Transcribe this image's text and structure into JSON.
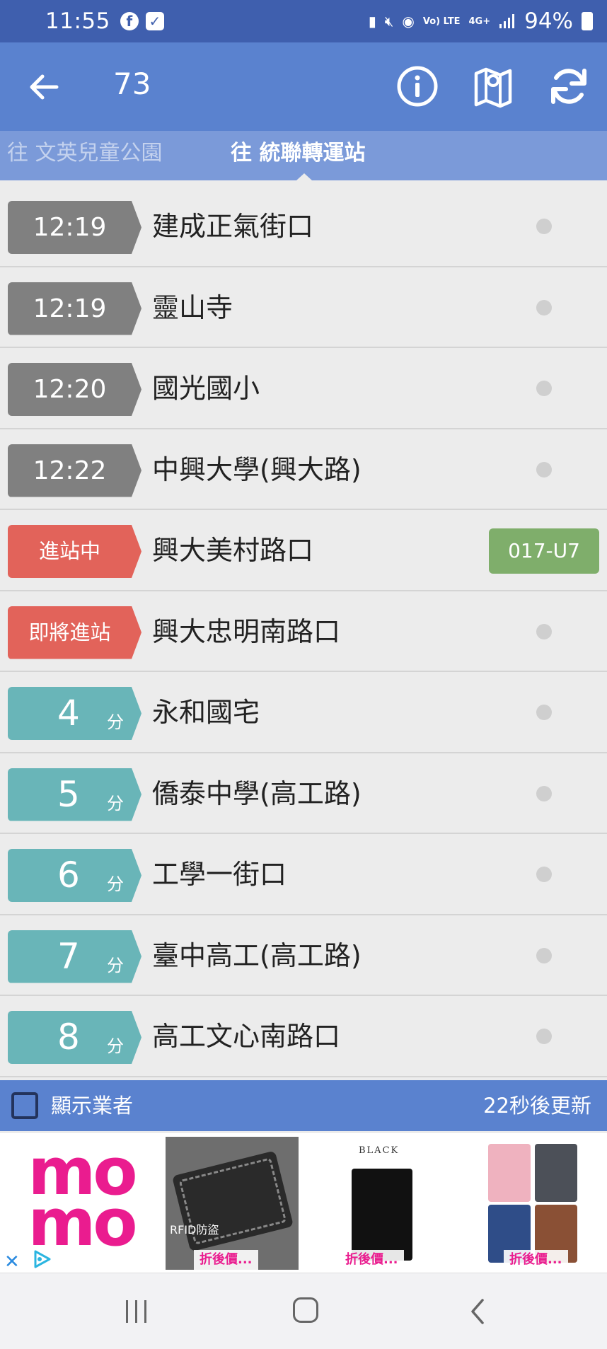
{
  "status_bar": {
    "time": "11:55",
    "notification_icons": [
      "facebook-icon",
      "check-box-icon"
    ],
    "system_icons": [
      "battery-saver-icon",
      "mute-icon",
      "hotspot-icon",
      "volte-icon",
      "data-4g-icon",
      "signal-icon"
    ],
    "volte_label": "Vo) LTE",
    "net_label": "4G+",
    "battery": "94%"
  },
  "app_bar": {
    "route_number": "73",
    "buttons": [
      "back-arrow-icon",
      "info-icon",
      "map-icon",
      "refresh-icon"
    ]
  },
  "tabs": [
    {
      "label": "往  文英兒童公園",
      "selected": false
    },
    {
      "label": "往  統聯轉運站",
      "selected": true
    }
  ],
  "stops": [
    {
      "eta": "12:19",
      "eta_kind": "time",
      "name": "建成正氣街口",
      "bus": ""
    },
    {
      "eta": "12:19",
      "eta_kind": "time",
      "name": "靈山寺",
      "bus": ""
    },
    {
      "eta": "12:20",
      "eta_kind": "time",
      "name": "國光國小",
      "bus": ""
    },
    {
      "eta": "12:22",
      "eta_kind": "time",
      "name": "中興大學(興大路)",
      "bus": ""
    },
    {
      "eta": "進站中",
      "eta_kind": "status",
      "name": "興大美村路口",
      "bus": "017-U7"
    },
    {
      "eta": "即將進站",
      "eta_kind": "status",
      "name": "興大忠明南路口",
      "bus": ""
    },
    {
      "eta": "4",
      "eta_unit": "分",
      "eta_kind": "minutes",
      "name": "永和國宅",
      "bus": ""
    },
    {
      "eta": "5",
      "eta_unit": "分",
      "eta_kind": "minutes",
      "name": "僑泰中學(高工路)",
      "bus": ""
    },
    {
      "eta": "6",
      "eta_unit": "分",
      "eta_kind": "minutes",
      "name": "工學一街口",
      "bus": ""
    },
    {
      "eta": "7",
      "eta_unit": "分",
      "eta_kind": "minutes",
      "name": "臺中高工(高工路)",
      "bus": ""
    },
    {
      "eta": "8",
      "eta_unit": "分",
      "eta_kind": "minutes",
      "name": "高工文心南路口",
      "bus": ""
    }
  ],
  "footer": {
    "checkbox_label": "顯示業者",
    "checked": false,
    "refresh_countdown": "22秒後更新"
  },
  "ad": {
    "brand_line1": "mo",
    "brand_line2": "mo",
    "rfid_label": "RFID防盜",
    "product1_price": "折後價...",
    "product2_brand": "BLACK",
    "product2_price": "折後價...",
    "product3_price": "折後價...",
    "close_glyph": "✕"
  },
  "colors": {
    "status_bar": "#3f5fae",
    "app_bar": "#5a82cf",
    "tabs": "#7b9ad9",
    "eta_time": "#808080",
    "eta_status": "#e2635a",
    "eta_minutes": "#69b5b8",
    "bus_badge": "#7fae6b",
    "ad_brand": "#ea1c8f"
  }
}
